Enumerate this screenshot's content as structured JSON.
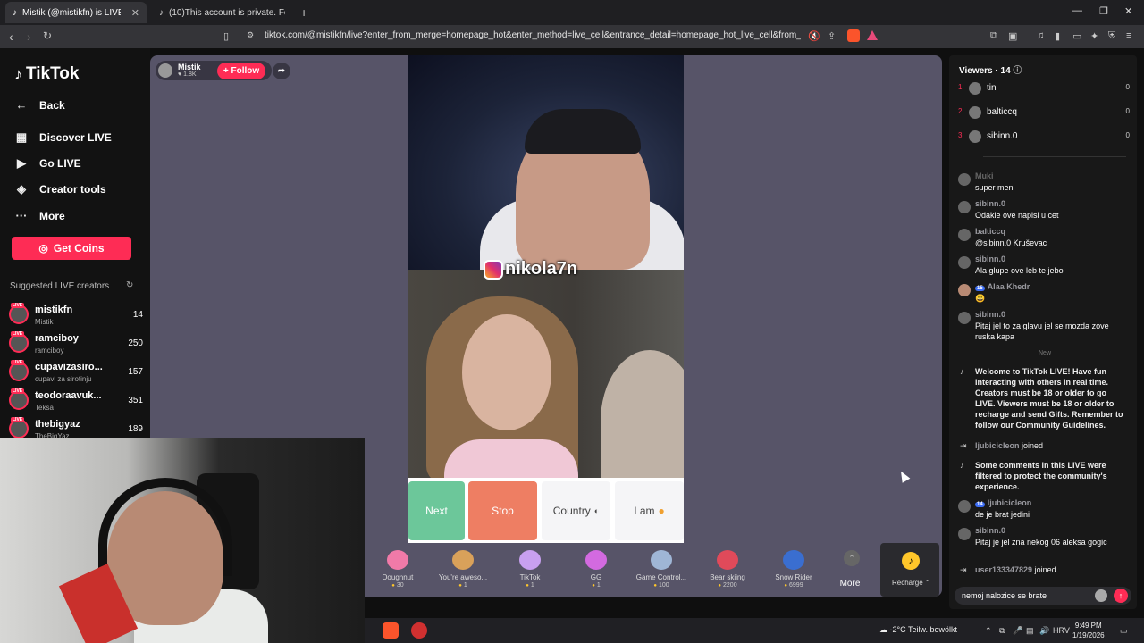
{
  "browser": {
    "tabs": [
      {
        "title": "Mistik (@mistikfn) is LIVE - Ti",
        "active": true
      },
      {
        "title": "(10)This account is private. Follow th",
        "active": false
      }
    ],
    "url": "tiktok.com/@mistikfn/live?enter_from_merge=homepage_hot&enter_method=live_cell&entrance_detail=homepage_hot_live_cell&from_play_m..."
  },
  "sidebar": {
    "logo": "TikTok",
    "back": "Back",
    "nav": [
      {
        "label": "Discover LIVE",
        "icon": "calendar-icon"
      },
      {
        "label": "Go LIVE",
        "icon": "video-camera-icon"
      },
      {
        "label": "Creator tools",
        "icon": "lightbulb-icon"
      },
      {
        "label": "More",
        "icon": "ellipsis-icon"
      }
    ],
    "get_coins": "Get Coins",
    "suggested_title": "Suggested LIVE creators",
    "creators": [
      {
        "name": "mistikfn",
        "sub": "Mistik",
        "count": "14"
      },
      {
        "name": "ramciboy",
        "sub": "ramciboy",
        "count": "250"
      },
      {
        "name": "cupavizasiro...",
        "sub": "cupavi za sirotinju",
        "count": "157"
      },
      {
        "name": "teodoraavuk...",
        "sub": "Teksa",
        "count": "351"
      },
      {
        "name": "thebigyaz",
        "sub": "TheBigYaz",
        "count": "189"
      }
    ]
  },
  "stream": {
    "host_name": "Mistik",
    "host_likes": "1.8K",
    "follow": "+ Follow",
    "overlay_tag": "nikola7n",
    "controls": {
      "next": "Next",
      "stop": "Stop",
      "country": "Country",
      "iam": "I am"
    }
  },
  "gifts": [
    {
      "name": "Doughnut",
      "price": "30",
      "color": "#f07aa8"
    },
    {
      "name": "You're aweso...",
      "price": "1",
      "color": "#d9a15a"
    },
    {
      "name": "TikTok",
      "price": "1",
      "color": "#c8a0f0"
    },
    {
      "name": "GG",
      "price": "1",
      "color": "#d36ae0"
    },
    {
      "name": "Game Control...",
      "price": "100",
      "color": "#9fb6d6"
    },
    {
      "name": "Bear skiing",
      "price": "2200",
      "color": "#e04a5a"
    },
    {
      "name": "Snow Rider",
      "price": "6999",
      "color": "#3a6ed0"
    }
  ],
  "more_label": "More",
  "recharge_label": "Recharge",
  "viewers": {
    "title": "Viewers",
    "count": "14",
    "list": [
      {
        "rank": "1",
        "name": "tin",
        "score": "0"
      },
      {
        "rank": "2",
        "name": "balticcq",
        "score": "0"
      },
      {
        "rank": "3",
        "name": "sibinn.0",
        "score": "0"
      }
    ]
  },
  "comments": [
    {
      "user": "Muki",
      "text": "super men",
      "tag": ""
    },
    {
      "user": "sibinn.0",
      "text": "Odakle ove napisi u cet",
      "tag": ""
    },
    {
      "user": "balticcq",
      "text": "@sibinn.0 Kruševac",
      "tag": ""
    },
    {
      "user": "sibinn.0",
      "text": "Ala glupe ove leb te jebo",
      "tag": ""
    },
    {
      "user": "Alaa Khedr",
      "text": "😀",
      "tag": "15"
    },
    {
      "user": "sibinn.0",
      "text": "Pitaj jel to za glavu jel se mozda zove ruska kapa",
      "tag": ""
    }
  ],
  "new_label": "New",
  "system": {
    "welcome": "Welcome to TikTok LIVE! Have fun interacting with others in real time. Creators must be 18 or older to go LIVE. Viewers must be 18 or older to recharge and send Gifts. Remember to follow our Community Guidelines.",
    "joined1_user": "ljubicicleon",
    "joined_word": "joined",
    "filtered": "Some comments in this LIVE were filtered to protect the community's experience."
  },
  "comments2": [
    {
      "user": "ljubicicleon",
      "text": "de je brat jedini",
      "tag": "14"
    },
    {
      "user": "sibinn.0",
      "text": "Pitaj je jel zna nekog 06 aleksa gogic",
      "tag": ""
    }
  ],
  "joined2_user": "user133347829",
  "input_value": "nemoj nalozice se brate",
  "taskbar": {
    "weather": "-2°C  Teilw. bewölkt",
    "lang": "HRV",
    "time": "9:49 PM",
    "date": "1/19/2026"
  }
}
